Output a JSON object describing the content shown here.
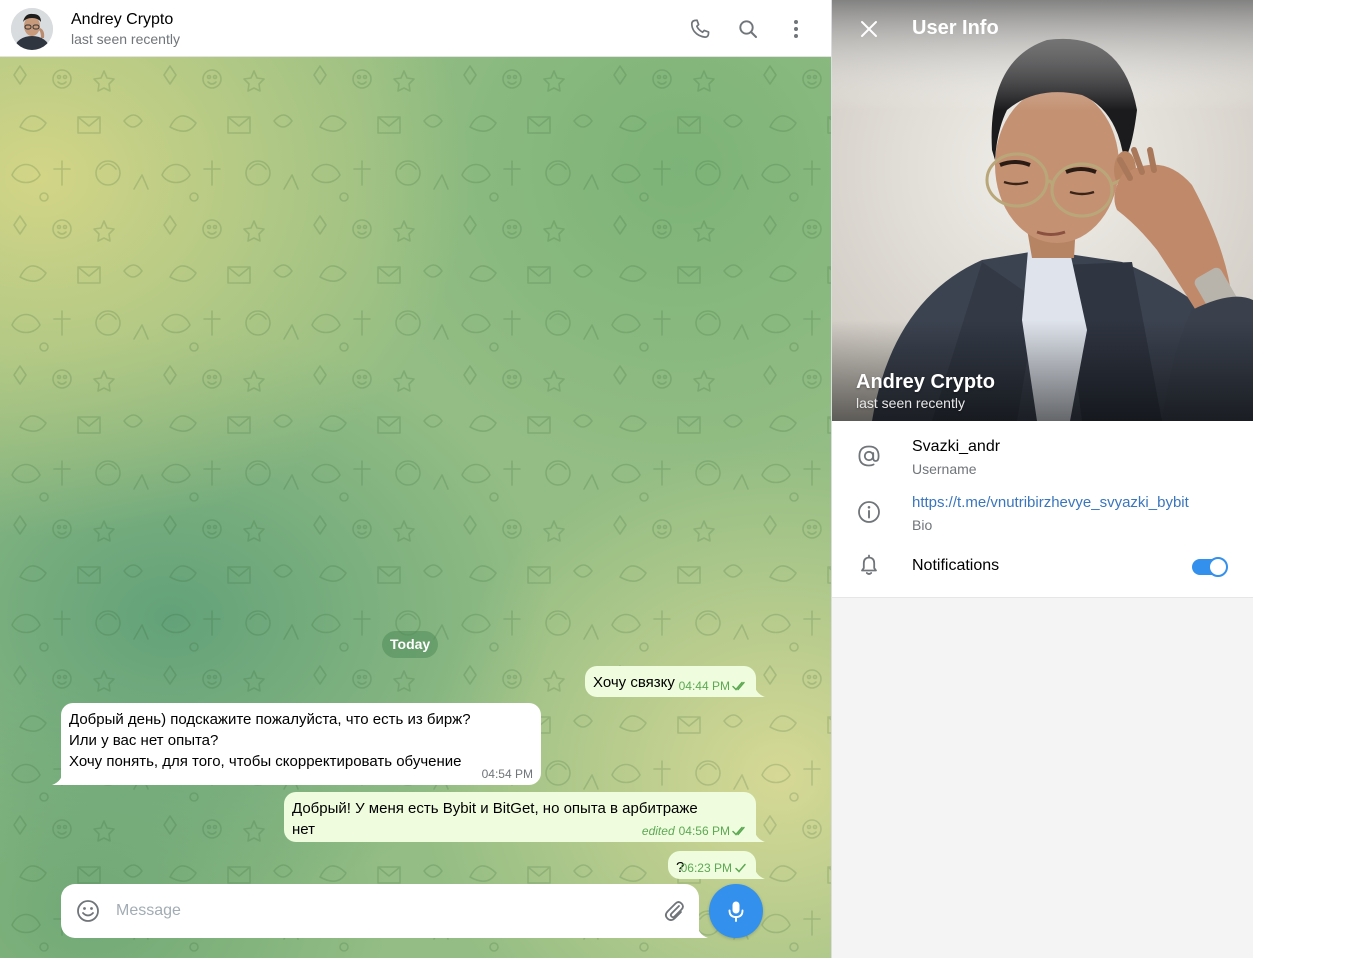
{
  "header": {
    "name": "Andrey Crypto",
    "status": "last seen recently",
    "icons": [
      "phone-icon",
      "search-icon",
      "more-vertical-icon"
    ]
  },
  "chat": {
    "date_label": "Today",
    "messages": [
      {
        "direction": "out",
        "text": "Хочу связку",
        "time": "04:44 PM",
        "read": true
      },
      {
        "direction": "in",
        "lines": [
          "Добрый день) подскажите пожалуйста, что есть из бирж?",
          "Или у вас нет опыта?",
          "Хочу понять, для того, чтобы скорректировать обучение"
        ],
        "time": "04:54 PM"
      },
      {
        "direction": "out",
        "lines": [
          "Добрый! У меня есть Bybit и BitGet,  но опыта в арбитраже",
          "нет"
        ],
        "edited_label": "edited",
        "time": "04:56 PM",
        "read": true
      },
      {
        "direction": "out",
        "text": "?",
        "time": "06:23 PM",
        "read": false
      }
    ]
  },
  "composer": {
    "placeholder": "Message",
    "value": ""
  },
  "user_info": {
    "title": "User Info",
    "name": "Andrey Crypto",
    "status": "last seen recently",
    "username": "Svazki_andr",
    "username_label": "Username",
    "bio": "https://t.me/vnutribirzhevye_svyazki_bybit",
    "bio_label": "Bio",
    "notifications_label": "Notifications",
    "notifications_on": true
  },
  "colors": {
    "accent": "#3390ec",
    "outgoing_bubble": "#effdde",
    "outgoing_meta": "#5ca853",
    "secondary_text": "#707579",
    "link": "#3a76bd"
  }
}
